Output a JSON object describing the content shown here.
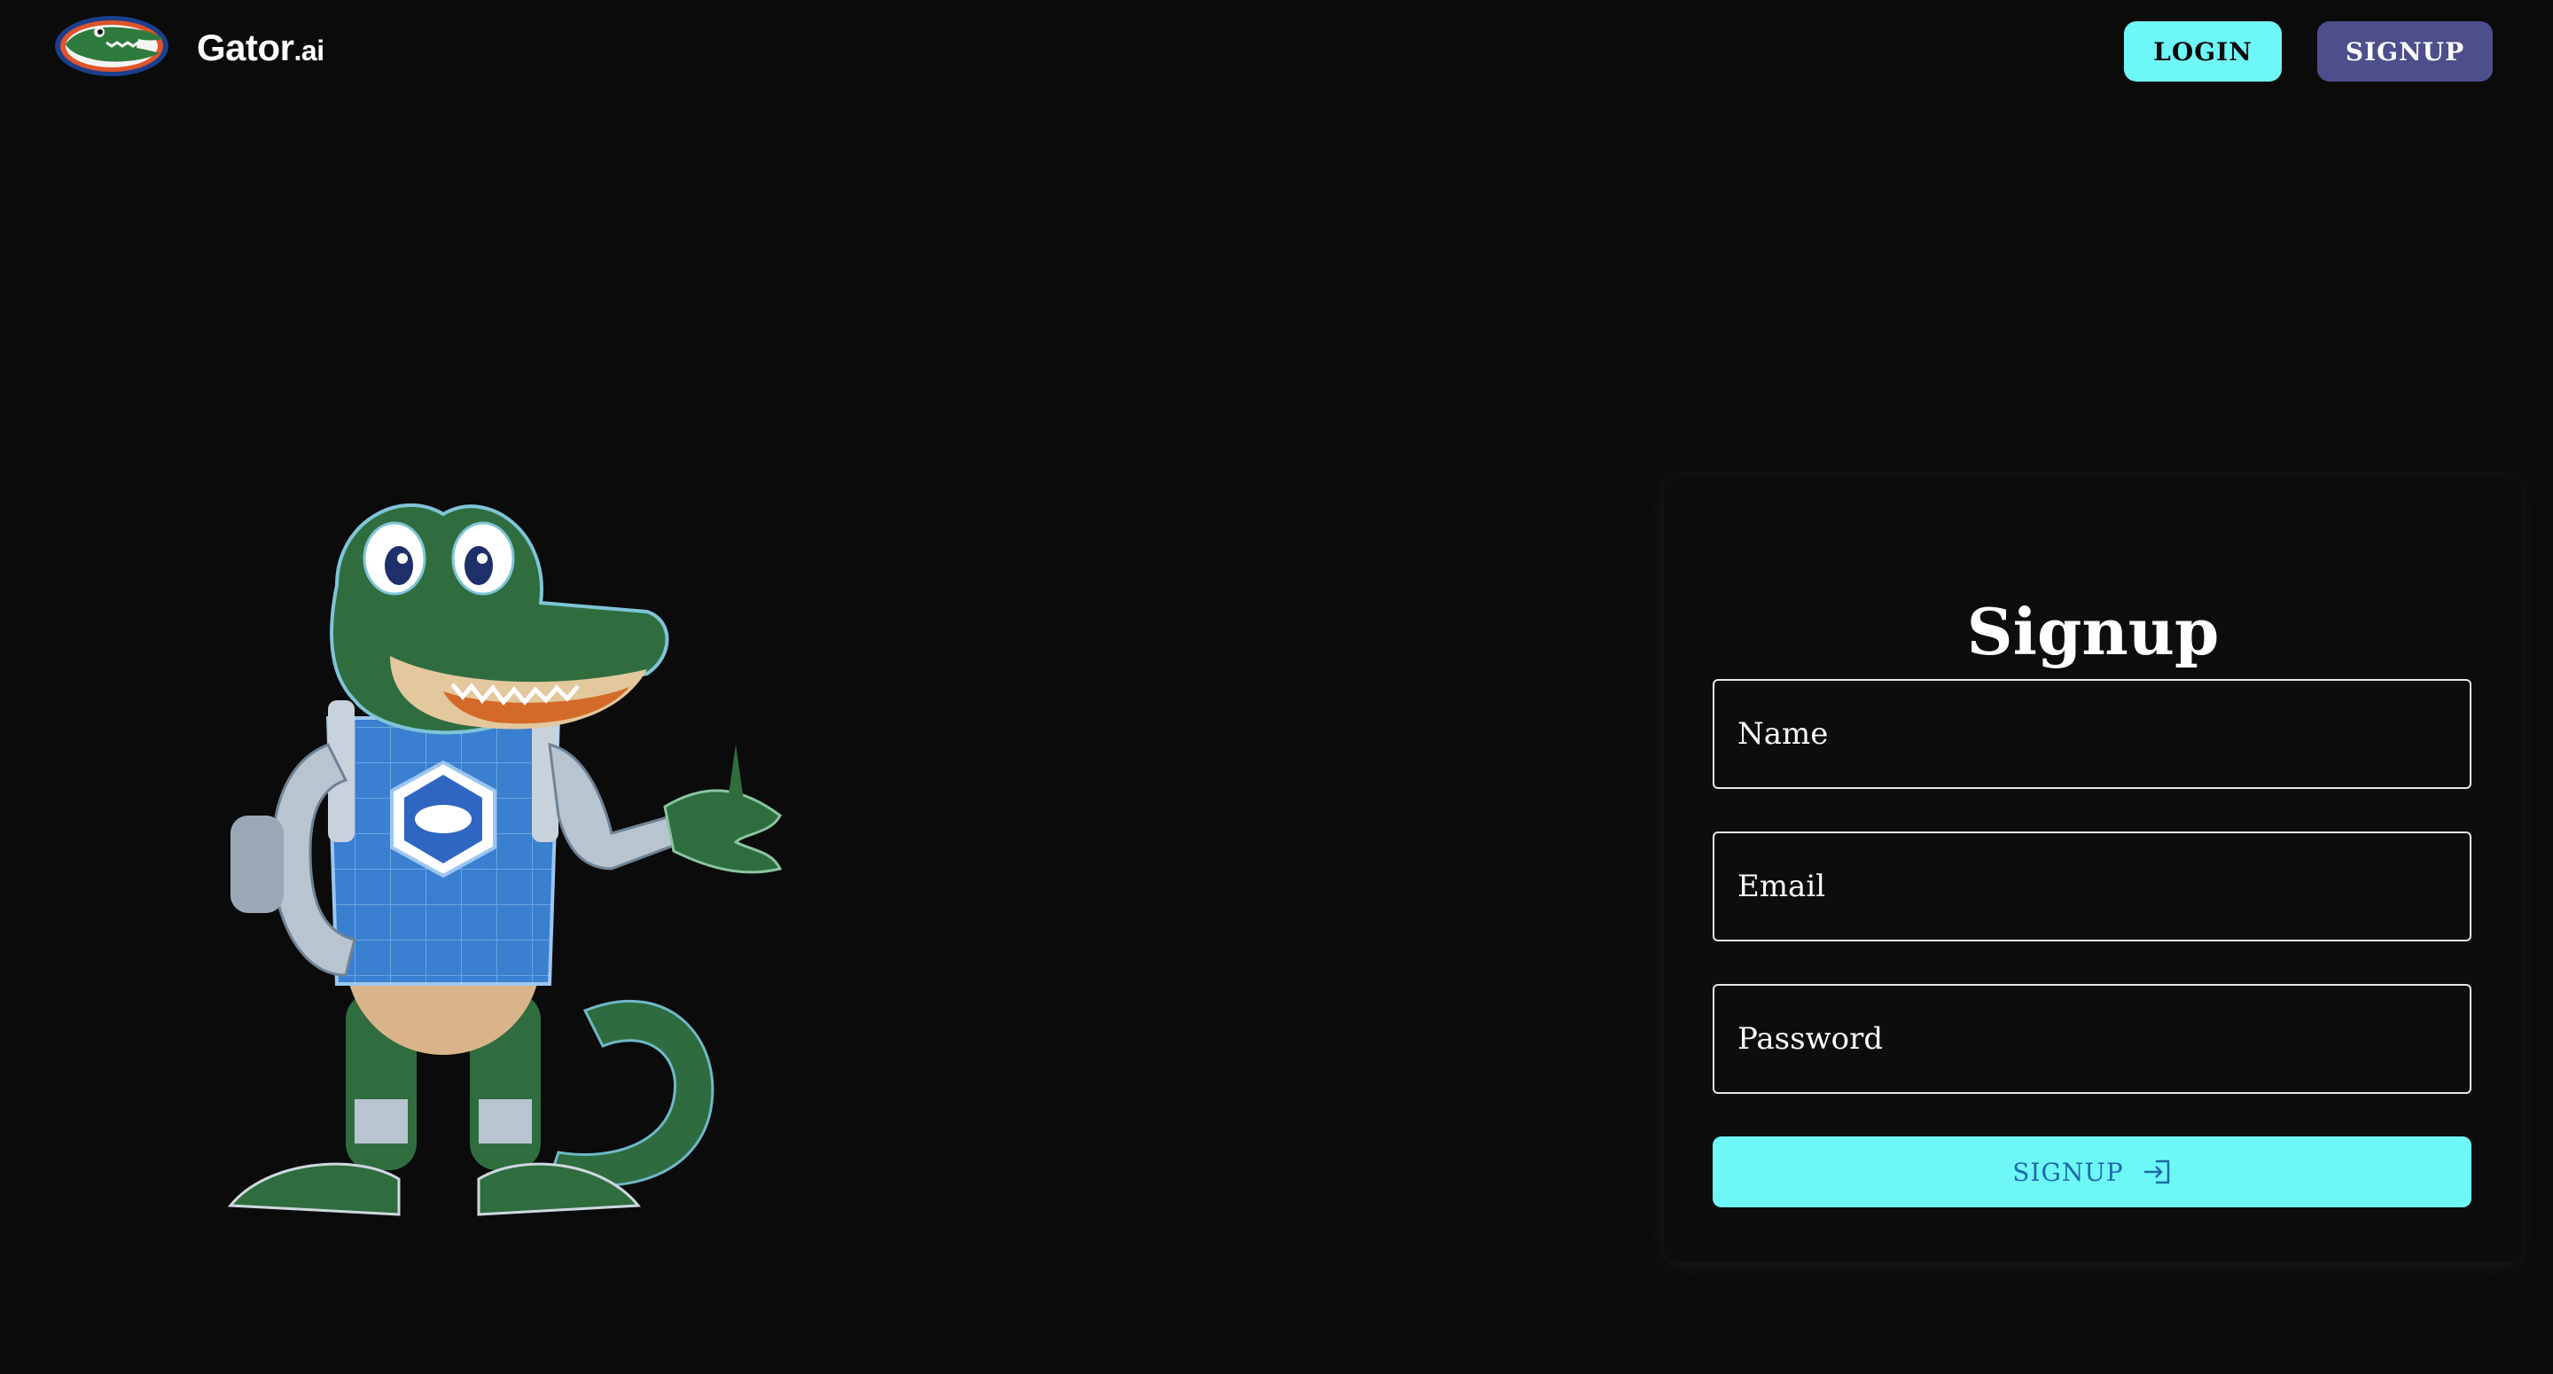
{
  "header": {
    "brand_name": "Gator",
    "brand_suffix": ".ai",
    "logo_icon": "gator-logo-icon",
    "login_label": "LOGIN",
    "signup_label": "SIGNUP"
  },
  "hero": {
    "mascot_icon": "robot-gator-mascot"
  },
  "form": {
    "title": "Signup",
    "name_placeholder": "Name",
    "email_placeholder": "Email",
    "password_placeholder": "Password",
    "submit_label": "SIGNUP",
    "submit_icon": "login-arrow-icon"
  },
  "colors": {
    "background": "#0b0b0b",
    "accent_cyan": "#6ef7f7",
    "signup_purple": "#4d4f8c",
    "submit_text": "#1f6aa8"
  }
}
